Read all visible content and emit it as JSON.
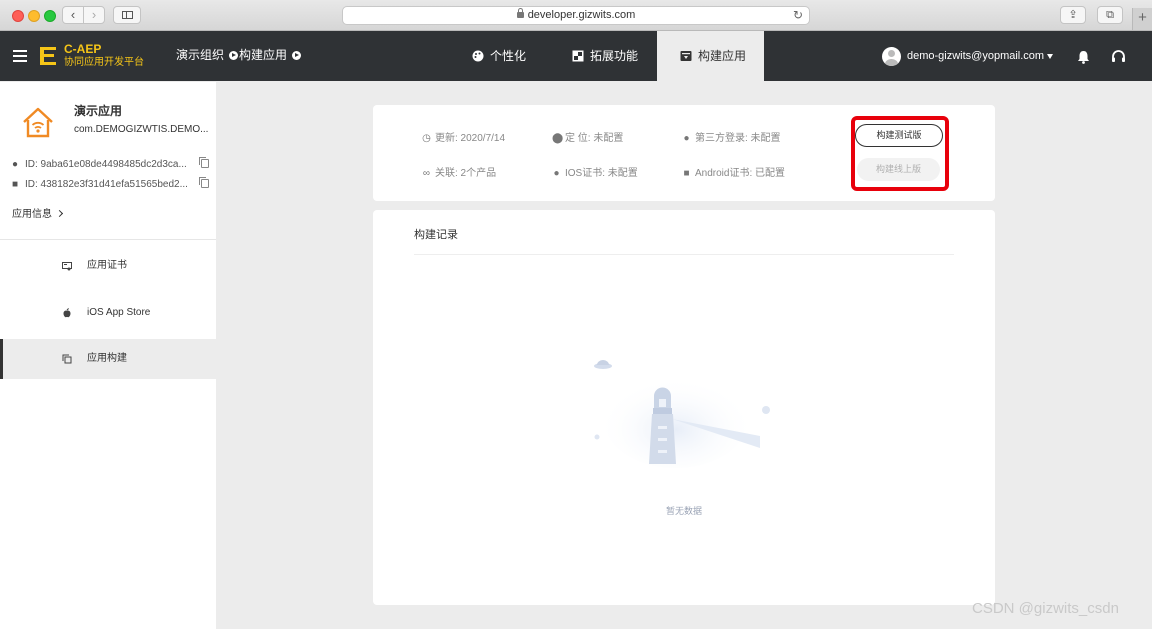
{
  "browser": {
    "url": "developer.gizwits.com",
    "back_glyph": "‹",
    "fwd_glyph": "›",
    "reload_glyph": "↻",
    "share_glyph": "⇪",
    "tabs_glyph": "⧉",
    "newtab_glyph": "+"
  },
  "header": {
    "brand_name": "C-AEP",
    "brand_sub": "协同应用开发平台",
    "breadcrumb": [
      "演示组织",
      "构建应用"
    ],
    "tabs": [
      {
        "label": "个性化",
        "icon": "palette-icon"
      },
      {
        "label": "拓展功能",
        "icon": "extension-icon"
      },
      {
        "label": "构建应用",
        "icon": "build-box-icon",
        "active": true
      }
    ],
    "user_email": "demo-gizwits@yopmail.com"
  },
  "sidebar": {
    "app_name": "演示应用",
    "app_package": "com.DEMOGIZWTIS.DEMO...",
    "ios_id": "ID:  9aba61e08de4498485dc2d3ca...",
    "android_id": "ID:  438182e3f31d41efa51565bed2...",
    "app_info_link": "应用信息",
    "menu": [
      {
        "label": "应用证书",
        "icon": "certificate-icon"
      },
      {
        "label": "iOS App Store",
        "icon": "apple-icon"
      },
      {
        "label": "应用构建",
        "icon": "copy-build-icon",
        "active": true
      }
    ]
  },
  "summary": {
    "updated": "更新: 2020/7/14",
    "location": "定 位: 未配置",
    "third_party_login": "第三方登录: 未配置",
    "linked": "关联: 2个产品",
    "ios_cert": "IOS证书: 未配置",
    "android_cert": "Android证书: 已配置",
    "build_test_label": "构建测试版",
    "build_release_label": "构建线上版"
  },
  "records": {
    "title": "构建记录",
    "empty_text": "暂无数据"
  },
  "watermark": "CSDN @gizwits_csdn",
  "colors": {
    "header_bg": "#2f3235",
    "brand_yellow": "#f5c518",
    "highlight_red": "#e8000b",
    "page_bg": "#ececec"
  }
}
